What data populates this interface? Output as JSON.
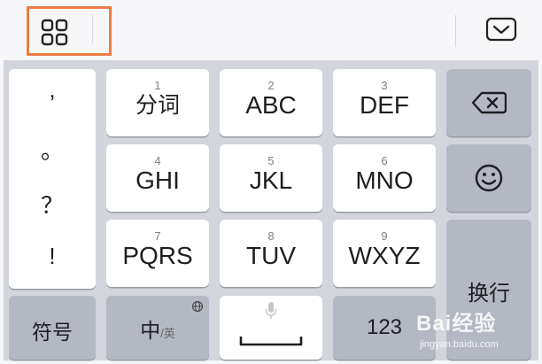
{
  "toolbar": {
    "menu_icon": "grid-four-squares-icon",
    "collapse_icon": "chevron-down-box-icon",
    "highlight_color": "#ee7d45"
  },
  "punctuation": [
    ",",
    "。",
    "？",
    "!"
  ],
  "keys": {
    "row1": [
      {
        "num": "1",
        "label": "分词"
      },
      {
        "num": "2",
        "label": "ABC"
      },
      {
        "num": "3",
        "label": "DEF"
      }
    ],
    "row2": [
      {
        "num": "4",
        "label": "GHI"
      },
      {
        "num": "5",
        "label": "JKL"
      },
      {
        "num": "6",
        "label": "MNO"
      }
    ],
    "row3": [
      {
        "num": "7",
        "label": "PQRS"
      },
      {
        "num": "8",
        "label": "TUV"
      },
      {
        "num": "9",
        "label": "WXYZ"
      }
    ],
    "backspace_icon": "backspace-icon",
    "emoji_icon": "smiley-icon",
    "enter_label": "换行"
  },
  "bottom": {
    "symbols": "符号",
    "lang_main": "中",
    "lang_alt": "/英",
    "lang_icon": "globe-icon",
    "space_icon": "microphone-icon",
    "numbers": "123"
  },
  "watermark": {
    "logo": "Bai经验",
    "url": "jingyan.baidu.com"
  }
}
